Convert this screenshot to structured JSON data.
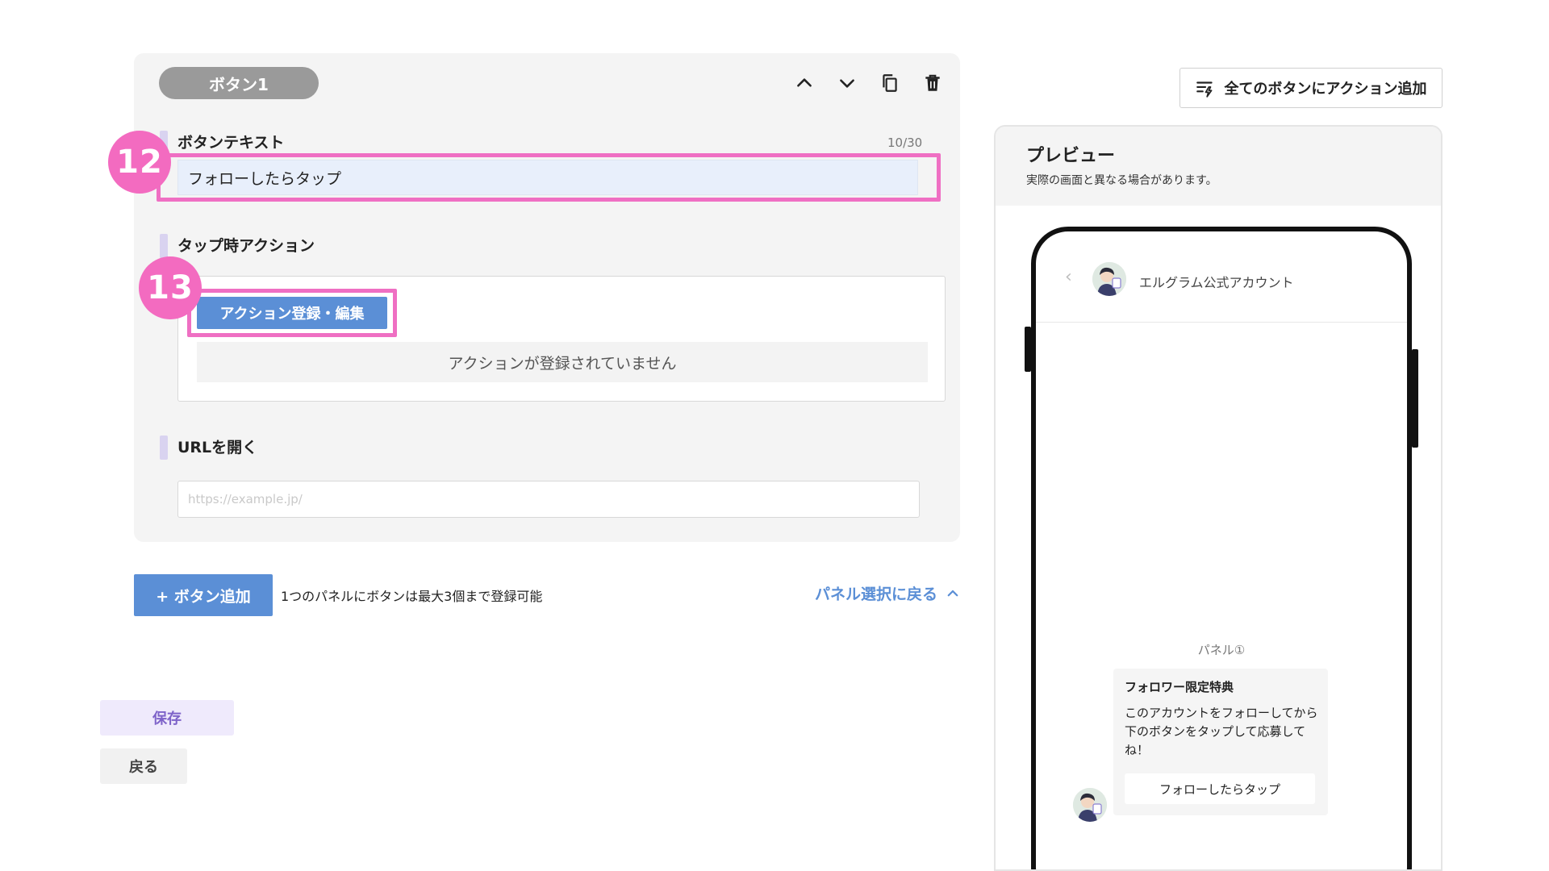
{
  "editor": {
    "button_tag": "ボタン1",
    "text_section": {
      "label": "ボタンテキスト",
      "counter": "10/30",
      "value": "フォローしたらタップ"
    },
    "action_section": {
      "label": "タップ時アクション",
      "register_button": "アクション登録・編集",
      "empty_message": "アクションが登録されていません"
    },
    "url_section": {
      "label": "URLを開く",
      "placeholder": "https://example.jp/"
    },
    "callouts": {
      "text_field": "12",
      "action_button": "13"
    }
  },
  "footer": {
    "add_button": "+ ボタン追加",
    "limit_note": "1つのパネルにボタンは最大3個まで登録可能",
    "back_to_panel": "パネル選択に戻る",
    "save": "保存",
    "return": "戻る"
  },
  "preview": {
    "add_all_actions": "全てのボタンにアクション追加",
    "title": "プレビュー",
    "subtitle": "実際の画面と異なる場合があります。",
    "account_name": "エルグラム公式アカウント",
    "panel_label": "パネル①",
    "bubble": {
      "title": "フォロワー限定特典",
      "body": "このアカウントをフォローしてから下のボタンをタップして応募してね！",
      "button": "フォローしたらタップ"
    }
  },
  "colors": {
    "accent_blue": "#5b8fd6",
    "highlight_pink": "#ef6fc3",
    "badge_pink": "#f36bc0",
    "section_bar": "#d9d3f0"
  }
}
